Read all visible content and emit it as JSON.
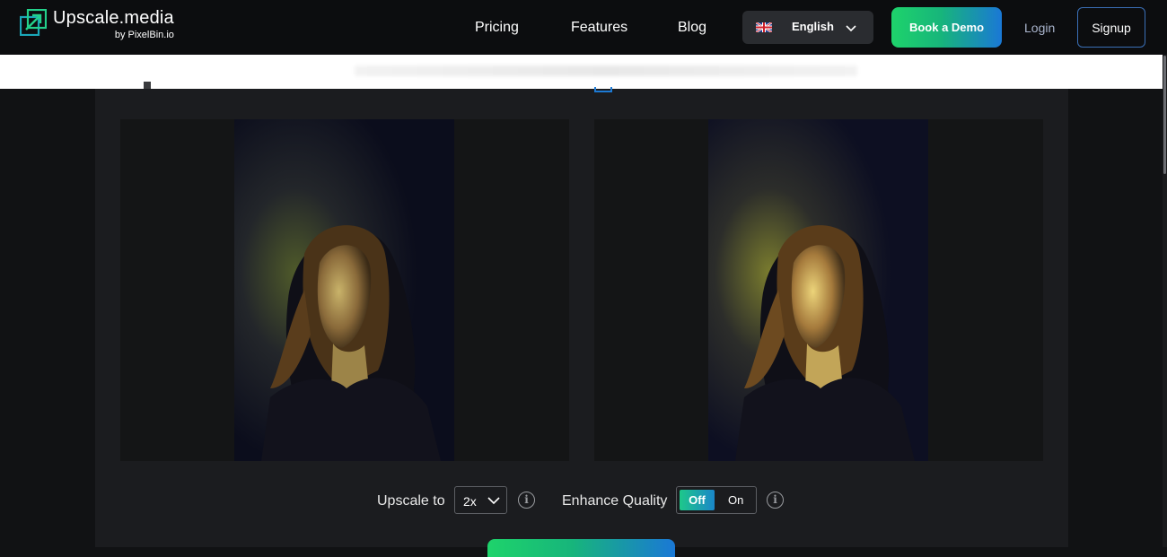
{
  "brand": {
    "title": "Upscale.media",
    "subtitle": "by PixelBin.io"
  },
  "nav": {
    "links": [
      "Pricing",
      "Features",
      "Blog"
    ],
    "language": {
      "flag": "uk-flag-icon",
      "label": "English"
    },
    "book_demo": "Book a Demo",
    "login": "Login",
    "signup": "Signup"
  },
  "controls": {
    "upscale_label": "Upscale to",
    "upscale_value": "2x",
    "enhance_label": "Enhance Quality",
    "toggle_off": "Off",
    "toggle_on": "On",
    "info_glyph": "i"
  },
  "images": {
    "left": "original-photo",
    "right": "upscaled-photo"
  },
  "colors": {
    "accent_green": "#1ed36b",
    "accent_blue": "#1a78d6",
    "background": "#111214"
  }
}
